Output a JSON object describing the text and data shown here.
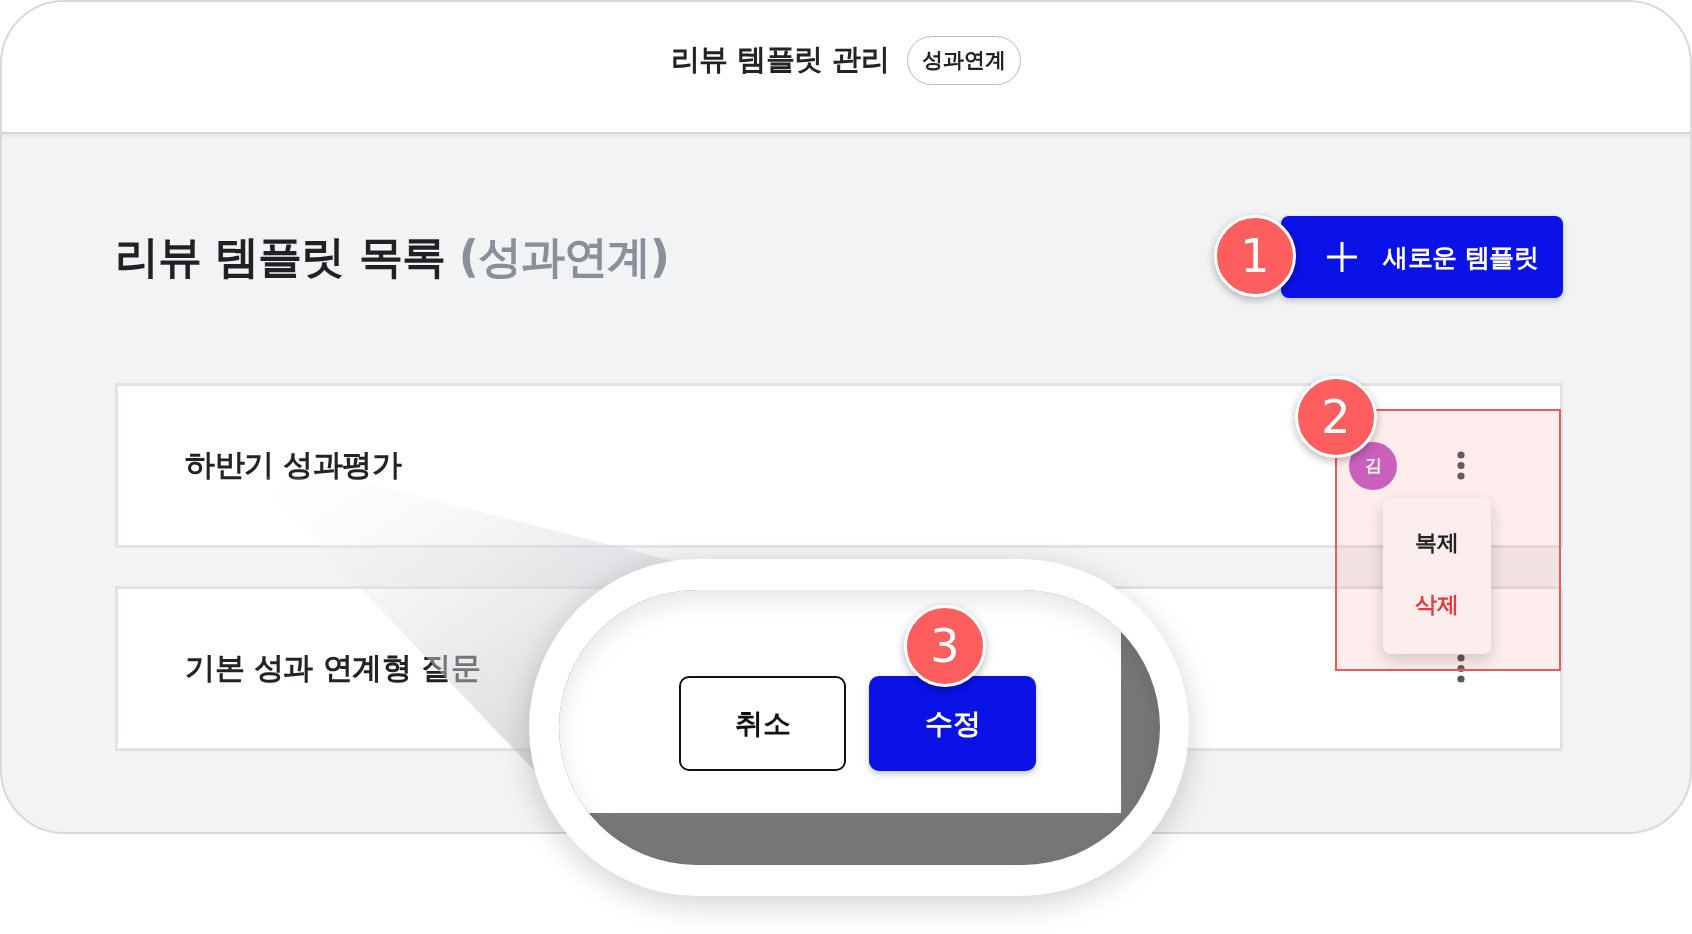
{
  "header": {
    "title": "리뷰 템플릿 관리",
    "badge": "성과연계"
  },
  "heading": {
    "title": "리뷰 템플릿 목록",
    "tag": "(성과연계)"
  },
  "new_template_button": {
    "label": "새로운 템플릿",
    "step": "1"
  },
  "templates": [
    {
      "title": "하반기 성과평가",
      "owner_avatar": "김",
      "menu_open": true
    },
    {
      "title": "기본 성과 연계형 질문",
      "menu_open": false
    }
  ],
  "context_menu": {
    "step": "2",
    "items": [
      {
        "label": "복제",
        "kind": "normal"
      },
      {
        "label": "삭제",
        "kind": "danger"
      }
    ]
  },
  "zoom_callout": {
    "step": "3",
    "buttons": [
      {
        "label": "취소",
        "kind": "secondary"
      },
      {
        "label": "수정",
        "kind": "primary"
      }
    ]
  }
}
